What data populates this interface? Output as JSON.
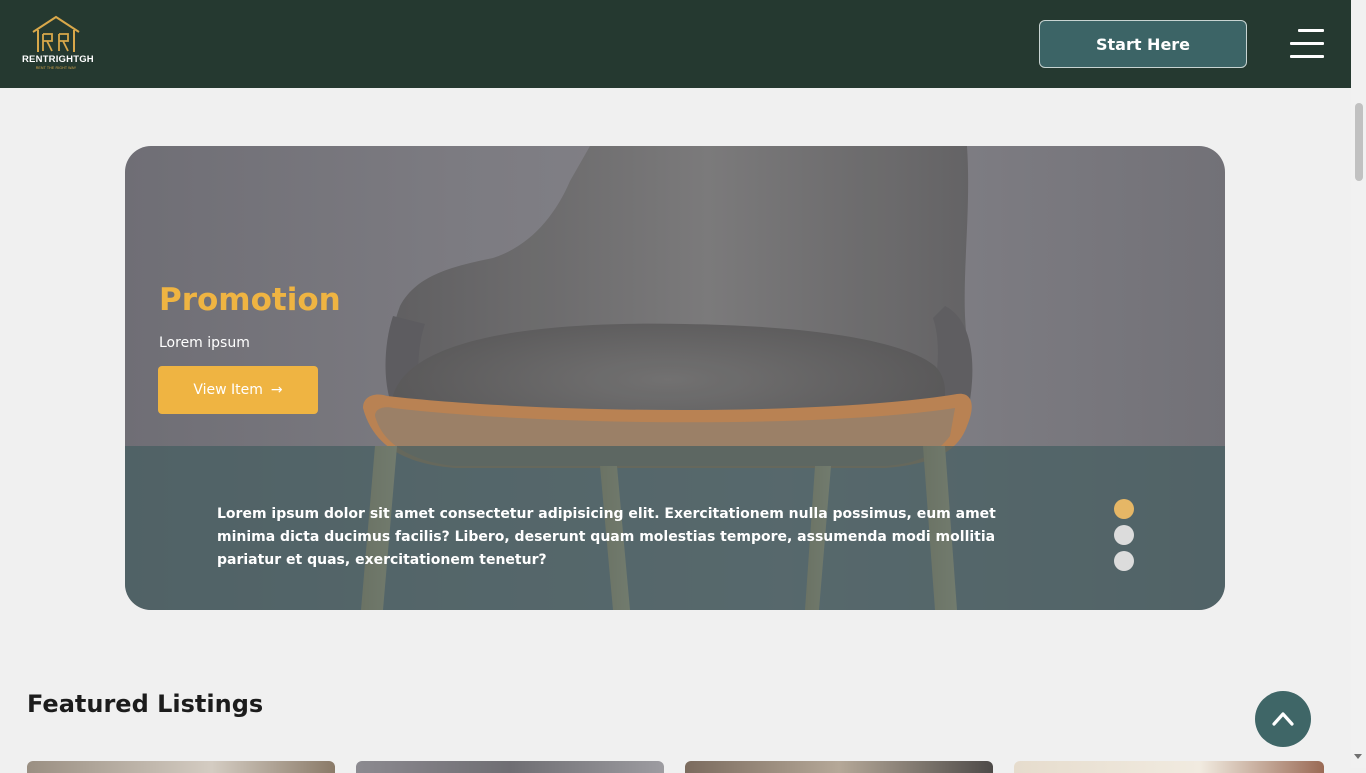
{
  "header": {
    "logo_text": "RENTRIGHTGH",
    "logo_tagline": "RENT THE RIGHT WAY",
    "start_button_label": "Start Here",
    "menu_icon": "hamburger-icon"
  },
  "promo": {
    "title": "Promotion",
    "subtitle": "Lorem ipsum",
    "button_label": "View Item",
    "button_icon": "arrow-right-icon",
    "button_arrow": "→",
    "description": "Lorem ipsum dolor sit amet consectetur adipisicing elit. Exercitationem nulla possimus, eum amet minima dicta ducimus facilis? Libero, deserunt quam molestias tempore, assumenda modi mollitia pariatur et quas, exercitationem tenetur?",
    "slides_count": 3,
    "active_slide": 1
  },
  "featured": {
    "title": "Featured Listings"
  },
  "scroll_top_icon": "chevron-up-icon",
  "colors": {
    "nav_bg": "#253930",
    "accent": "#efb442",
    "teal_button": "#3c6466",
    "page_bg": "#f0f0f0"
  }
}
